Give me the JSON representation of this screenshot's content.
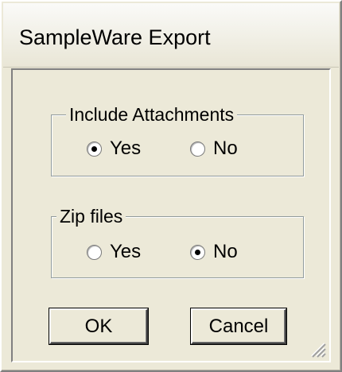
{
  "window": {
    "title": "SampleWare Export"
  },
  "include_attachments": {
    "label": "Include Attachments",
    "yes_label": "Yes",
    "no_label": "No",
    "selected": "Yes"
  },
  "zip_files": {
    "label": "Zip files",
    "yes_label": "Yes",
    "no_label": "No",
    "selected": "No"
  },
  "buttons": {
    "ok_label": "OK",
    "cancel_label": "Cancel"
  },
  "icons": {
    "radio_selected": "radio-selected-icon",
    "radio_unselected": "radio-unselected-icon",
    "resize_grip": "resize-grip-icon"
  }
}
